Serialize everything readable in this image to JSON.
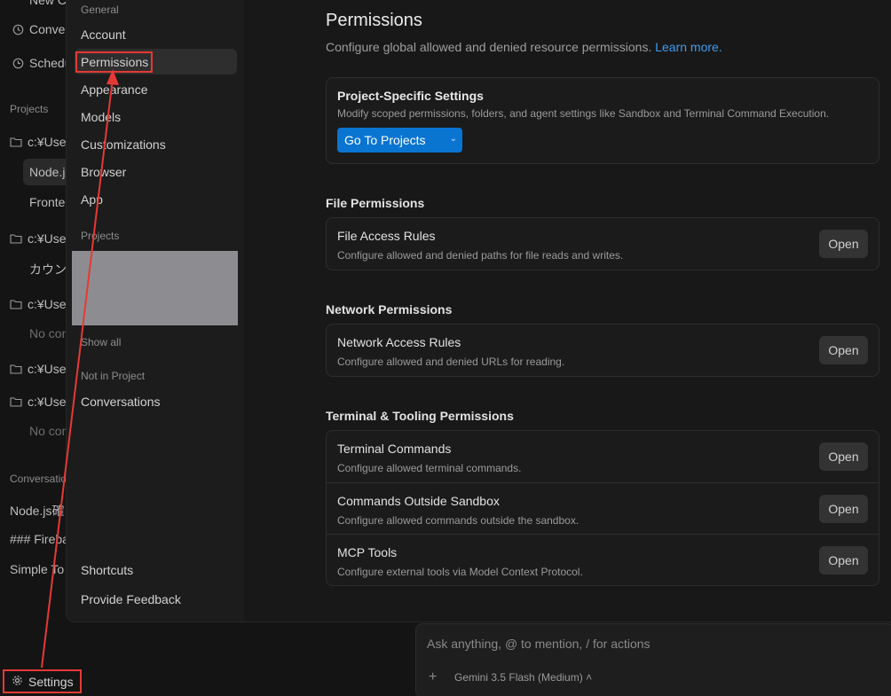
{
  "background_sidebar": {
    "rows": [
      {
        "text": "New C",
        "icon": "none",
        "dim": false
      },
      {
        "text": "Conve",
        "icon": "history-icon",
        "dim": false
      },
      {
        "text": "Schedu",
        "icon": "clock-icon",
        "dim": false
      },
      {
        "text": "c:¥Use",
        "icon": "folder-icon",
        "dim": false
      },
      {
        "text": "Node.js",
        "icon": "none",
        "dim": false
      },
      {
        "text": "Fronte",
        "icon": "none",
        "dim": false
      },
      {
        "text": "c:¥Use",
        "icon": "folder-icon",
        "dim": false
      },
      {
        "text": "カウンタ",
        "icon": "none",
        "dim": false
      },
      {
        "text": "c:¥Use",
        "icon": "folder-icon",
        "dim": false
      },
      {
        "text": "No con",
        "icon": "none",
        "dim": true
      },
      {
        "text": "c:¥Use",
        "icon": "folder-icon",
        "dim": false
      },
      {
        "text": "c:¥Use",
        "icon": "folder-icon",
        "dim": false
      },
      {
        "text": "No con",
        "icon": "none",
        "dim": true
      },
      {
        "text": "Node.js確",
        "icon": "none",
        "dim": false
      },
      {
        "text": "### Fireba",
        "icon": "none",
        "dim": false
      },
      {
        "text": "Simple To",
        "icon": "none",
        "dim": false
      }
    ],
    "sections": {
      "projects": "Projects",
      "conversations": "Conversatio"
    },
    "settings_label": "Settings"
  },
  "chat": {
    "placeholder": "Ask anything, @ to mention, / for actions",
    "plus": "+",
    "model": "Gemini 3.5 Flash (Medium)",
    "model_chevron": "˄"
  },
  "settings_nav": {
    "general_label": "General",
    "general_items": [
      "Account",
      "Permissions",
      "Appearance",
      "Models",
      "Customizations",
      "Browser",
      "App"
    ],
    "active_item": "Permissions",
    "projects_label": "Projects",
    "show_all": "Show all",
    "not_in_project_label": "Not in Project",
    "conversations": "Conversations",
    "shortcuts": "Shortcuts",
    "feedback": "Provide Feedback"
  },
  "permissions": {
    "title": "Permissions",
    "subtitle": "Configure global allowed and denied resource permissions.",
    "learn_more": "Learn more.",
    "project_specific": {
      "title": "Project-Specific Settings",
      "description": "Modify scoped permissions, folders, and agent settings like Sandbox and Terminal Command Execution.",
      "button": "Go To Projects",
      "button_chevron": "⌄"
    },
    "file_section": "File Permissions",
    "network_section": "Network Permissions",
    "terminal_section": "Terminal & Tooling Permissions",
    "open_label": "Open",
    "file_rows": [
      {
        "title": "File Access Rules",
        "desc": "Configure allowed and denied paths for file reads and writes."
      }
    ],
    "network_rows": [
      {
        "title": "Network Access Rules",
        "desc": "Configure allowed and denied URLs for reading."
      }
    ],
    "terminal_rows": [
      {
        "title": "Terminal Commands",
        "desc": "Configure allowed terminal commands."
      },
      {
        "title": "Commands Outside Sandbox",
        "desc": "Configure allowed commands outside the sandbox."
      },
      {
        "title": "MCP Tools",
        "desc": "Configure external tools via Model Context Protocol."
      }
    ]
  },
  "colors": {
    "accent": "#0a74d1",
    "link": "#3b9cf0",
    "annotation": "#e53935"
  }
}
